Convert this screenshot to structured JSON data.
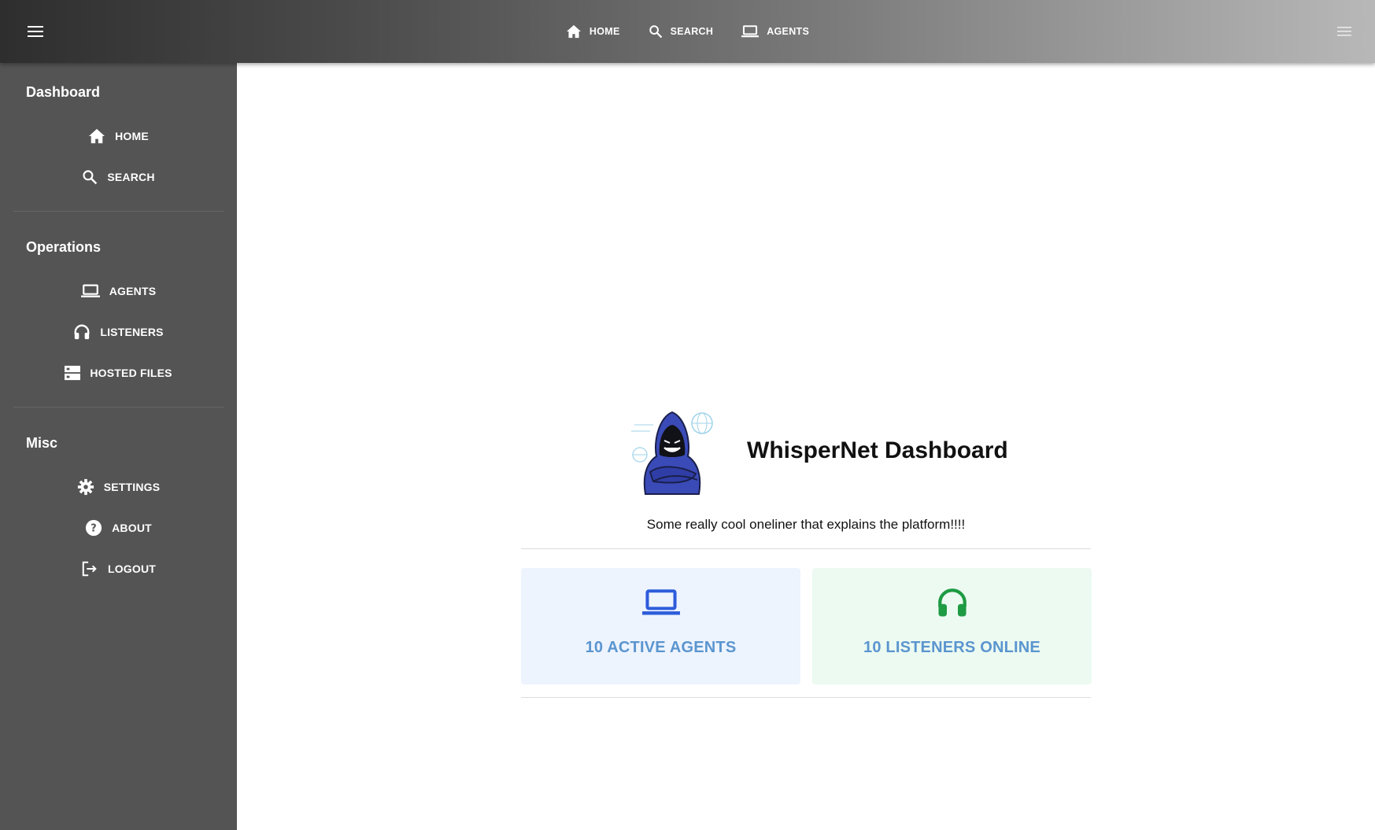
{
  "topbar": {
    "nav": [
      {
        "label": "HOME",
        "icon": "home-icon"
      },
      {
        "label": "SEARCH",
        "icon": "search-icon"
      },
      {
        "label": "AGENTS",
        "icon": "laptop-icon"
      }
    ]
  },
  "sidebar": {
    "sections": [
      {
        "title": "Dashboard",
        "items": [
          {
            "label": "HOME",
            "icon": "home-icon"
          },
          {
            "label": "SEARCH",
            "icon": "search-icon"
          }
        ]
      },
      {
        "title": "Operations",
        "items": [
          {
            "label": "AGENTS",
            "icon": "laptop-icon"
          },
          {
            "label": "LISTENERS",
            "icon": "headphones-icon"
          },
          {
            "label": "HOSTED FILES",
            "icon": "storage-icon"
          }
        ]
      },
      {
        "title": "Misc",
        "items": [
          {
            "label": "SETTINGS",
            "icon": "gear-icon"
          },
          {
            "label": "ABOUT",
            "icon": "help-icon"
          },
          {
            "label": "LOGOUT",
            "icon": "logout-icon"
          }
        ]
      }
    ]
  },
  "main": {
    "title": "WhisperNet Dashboard",
    "tagline": "Some really cool oneliner that explains the platform!!!!",
    "cards": [
      {
        "label": "10 ACTIVE AGENTS",
        "icon": "laptop-icon",
        "icon_color": "#2e5cdb",
        "background": "#edf4fe"
      },
      {
        "label": "10 LISTENERS ONLINE",
        "icon": "headphones-icon",
        "icon_color": "#1e9b43",
        "background": "#ecfaf1"
      }
    ]
  },
  "colors": {
    "sidebar_bg": "#545454",
    "card_label": "#5b95cf"
  }
}
